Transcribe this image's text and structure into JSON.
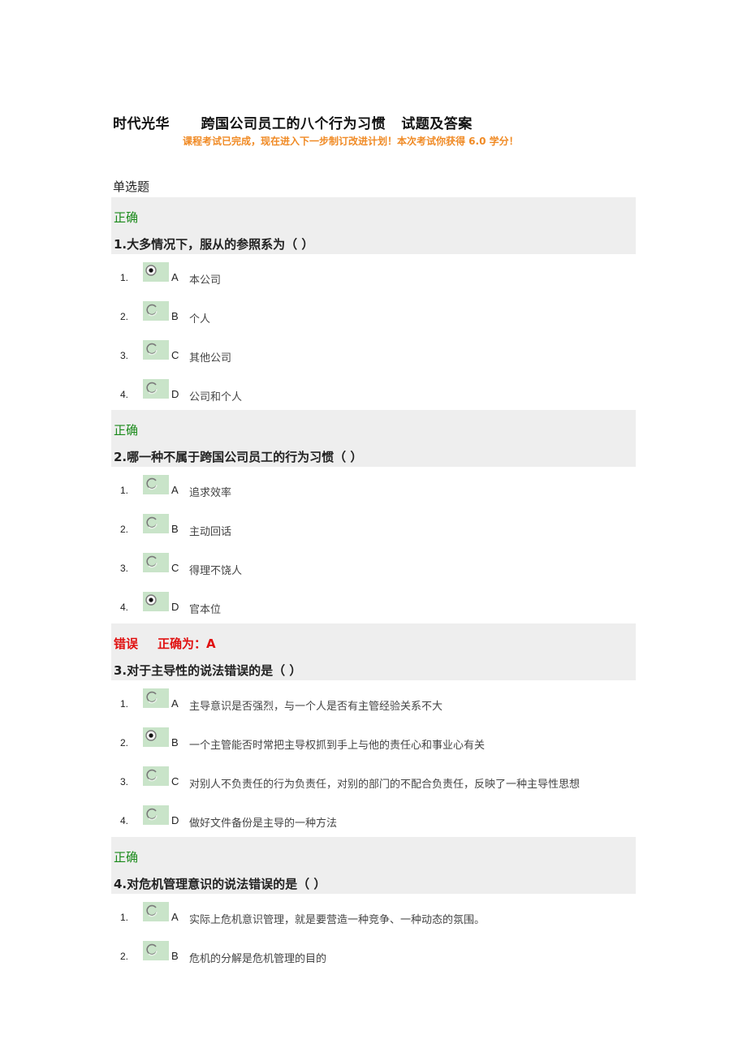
{
  "header": {
    "title": "时代光华      跨国公司员工的八个行为习惯   试题及答案",
    "notice": "课程考试已完成，现在进入下一步制订改进计划！本次考试你获得 6.0 学分！"
  },
  "section_label": "单选题",
  "colors": {
    "correct": "#1a8a1a",
    "wrong": "#e01010",
    "notice": "#f08a24",
    "question_bg": "#eeeeee",
    "radio_bg": "#c9e4c9"
  },
  "questions": [
    {
      "status": "正确",
      "status_type": "correct",
      "correct_answer": "",
      "number": "1.",
      "text": "大多情况下，服从的参照系为（ ）",
      "options": [
        {
          "index": "1.",
          "letter": "A",
          "text": "本公司",
          "selected": true
        },
        {
          "index": "2.",
          "letter": "B",
          "text": "个人",
          "selected": false
        },
        {
          "index": "3.",
          "letter": "C",
          "text": "其他公司",
          "selected": false
        },
        {
          "index": "4.",
          "letter": "D",
          "text": "公司和个人",
          "selected": false
        }
      ]
    },
    {
      "status": "正确",
      "status_type": "correct",
      "correct_answer": "",
      "number": "2.",
      "text": "哪一种不属于跨国公司员工的行为习惯（ ）",
      "options": [
        {
          "index": "1.",
          "letter": "A",
          "text": "追求效率",
          "selected": false
        },
        {
          "index": "2.",
          "letter": "B",
          "text": "主动回话",
          "selected": false
        },
        {
          "index": "3.",
          "letter": "C",
          "text": "得理不饶人",
          "selected": false
        },
        {
          "index": "4.",
          "letter": "D",
          "text": "官本位",
          "selected": true
        }
      ]
    },
    {
      "status": "错误",
      "status_type": "wrong",
      "correct_answer": "正确为：A",
      "number": "3.",
      "text": "对于主导性的说法错误的是（ ）",
      "options": [
        {
          "index": "1.",
          "letter": "A",
          "text": "主导意识是否强烈，与一个人是否有主管经验关系不大",
          "selected": false
        },
        {
          "index": "2.",
          "letter": "B",
          "text": "一个主管能否时常把主导权抓到手上与他的责任心和事业心有关",
          "selected": true
        },
        {
          "index": "3.",
          "letter": "C",
          "text": "对别人不负责任的行为负责任，对别的部门的不配合负责任，反映了一种主导性思想",
          "selected": false
        },
        {
          "index": "4.",
          "letter": "D",
          "text": "做好文件备份是主导的一种方法",
          "selected": false
        }
      ]
    },
    {
      "status": "正确",
      "status_type": "correct",
      "correct_answer": "",
      "number": "4.",
      "text": "对危机管理意识的说法错误的是（ ）",
      "options": [
        {
          "index": "1.",
          "letter": "A",
          "text": "实际上危机意识管理，就是要营造一种竞争、一种动态的氛围。",
          "selected": false
        },
        {
          "index": "2.",
          "letter": "B",
          "text": "危机的分解是危机管理的目的",
          "selected": false
        }
      ]
    }
  ]
}
